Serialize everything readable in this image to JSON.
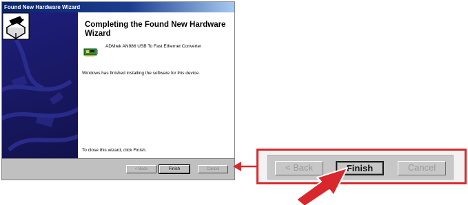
{
  "window": {
    "title": "Found New Hardware Wizard"
  },
  "wizard": {
    "heading": "Completing the Found New Hardware Wizard",
    "device_name": "ADMtek AN986 USB To Fast Ethernet Converter",
    "finished_message": "Windows has finished installing the software for this device.",
    "close_instruction": "To close this wizard, click Finish."
  },
  "buttons": {
    "back_label": "< Back",
    "finish_label": "Finish",
    "cancel_label": "Cancel"
  },
  "zoom_buttons": {
    "back_label": "< Back",
    "finish_label": "Finish",
    "cancel_label": "Cancel"
  },
  "colors": {
    "highlight": "#d8282d",
    "titlebar": "#0a246a",
    "side_panel": "#1d1e7c"
  },
  "icons": {
    "wizard": "wizard-box-icon",
    "device": "network-card-icon",
    "pointer": "arrow-icon"
  }
}
